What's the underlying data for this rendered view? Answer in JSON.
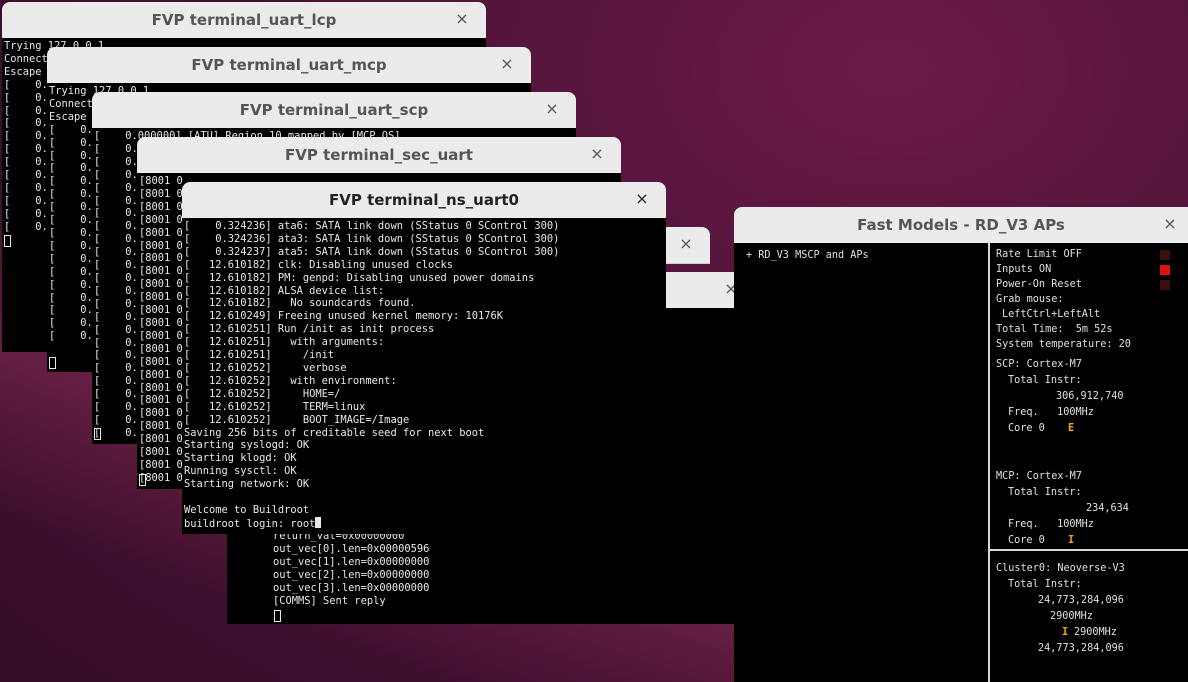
{
  "windows": {
    "lcp": {
      "title": "FVP terminal_uart_lcp",
      "lines": [
        "Trying 127.0.0.1",
        "Connect",
        "Escape",
        "[    0.",
        "[    0.",
        "[    0.",
        "[    0.",
        "[    0.",
        "[    0.",
        "[    0.",
        "[    0.",
        "[    0.",
        "[    0.",
        "[    0.",
        "[    0."
      ]
    },
    "mcp": {
      "title": "FVP terminal_uart_mcp",
      "lines": [
        "Trying 127.0.0.1",
        "Connect",
        "Escape",
        "[    0.",
        "[    0.",
        "[    0.",
        "[    0.",
        "[    0.",
        "[    0.",
        "[    0.",
        "[    0.",
        "[    0.",
        "[    0.",
        "[    0.",
        "[    0.",
        "[    0.",
        "[    0.",
        "[    0.",
        "[    0.",
        "[    0."
      ]
    },
    "scp": {
      "title": "FVP terminal_uart_scp",
      "lines": [
        "[    0.000000] [ATU] Region 10 mapped by [MCP_OS]",
        "[    0.",
        "[    0.",
        "[    0.",
        "[    0.",
        "[    0.",
        "[    0.",
        "[    0.",
        "[    0.",
        "[    0.",
        "[    0.",
        "[    0.",
        "[    0.",
        "[    0.",
        "[    0.",
        "[    0.",
        "[    0.",
        "[    0.",
        "[    0.",
        "[    0.",
        "[    0.",
        "[    0.",
        "[    0.",
        "[    0."
      ]
    },
    "sec": {
      "title": "FVP terminal_sec_uart",
      "lines": [
        "[8001 0",
        "[8001 0",
        "[8001 0",
        "[8001 0",
        "[8001 0",
        "[8001 0",
        "[8001 0",
        "[8001 0",
        "[8001 0",
        "[8001 0",
        "[8001 0",
        "[8001 0",
        "[8001 0",
        "[8001 0",
        "[8001 0",
        "[8001 0",
        "[8001 0",
        "[8001 0",
        "[8001 0",
        "[8001 0",
        "[8001 0",
        "[8001 0",
        "[8001 0",
        "[8001 0"
      ]
    },
    "ns": {
      "title": "FVP terminal_ns_uart0",
      "lines": [
        "[    0.324236] ata6: SATA link down (SStatus 0 SControl 300)",
        "[    0.324236] ata3: SATA link down (SStatus 0 SControl 300)",
        "[    0.324237] ata5: SATA link down (SStatus 0 SControl 300)",
        "[   12.610182] clk: Disabling unused clocks",
        "[   12.610182] PM: genpd: Disabling unused power domains",
        "[   12.610182] ALSA device list:",
        "[   12.610182]   No soundcards found.",
        "[   12.610249] Freeing unused kernel memory: 10176K",
        "[   12.610251] Run /init as init process",
        "[   12.610251]   with arguments:",
        "[   12.610251]     /init",
        "[   12.610252]     verbose",
        "[   12.610252]   with environment:",
        "[   12.610252]     HOME=/",
        "[   12.610252]     TERM=linux",
        "[   12.610252]     BOOT_IMAGE=/Image",
        "Saving 256 bits of creditable seed for next boot",
        "Starting syslogd: OK",
        "Starting klogd: OK",
        "Running sysctl: OK",
        "Starting network: OK",
        "",
        "Welcome to Buildroot"
      ],
      "prompt": "buildroot login: root"
    },
    "rmm": {
      "lines": [
        "return_val=0x00000000",
        "out_vec[0].len=0x00000596",
        "out_vec[1].len=0x00000000",
        "out_vec[2].len=0x00000000",
        "out_vec[3].len=0x00000000",
        "[COMMS] Sent reply"
      ]
    },
    "close_glyph": "×"
  },
  "fast_models": {
    "title": "Fast Models - RD_V3 APs",
    "tree_item": "+ RD_V3 MSCP and APs",
    "status": {
      "rate_limit": "Rate Limit OFF",
      "inputs": "Inputs ON",
      "power_on_reset": "Power-On Reset",
      "grab_mouse_label": "Grab mouse:",
      "grab_mouse_value": "LeftCtrl+LeftAlt",
      "total_time": "Total Time:  5m 52s",
      "system_temperature": "System temperature: 20"
    },
    "scp": {
      "name": "SCP: Cortex-M7",
      "total_instr_label": "Total Instr:",
      "total_instr_value": "306,912,740",
      "freq": "Freq.   100MHz",
      "core_label": "Core 0",
      "core_glyph": "E"
    },
    "mcp": {
      "name": "MCP: Cortex-M7",
      "total_instr_label": "Total Instr:",
      "total_instr_value": "234,634",
      "freq": "Freq.   100MHz",
      "core_label": "Core 0",
      "core_glyph": "I"
    },
    "cluster0": {
      "name": "Cluster0: Neoverse-V3",
      "total_instr_label": "Total Instr:",
      "total_instr_value": "24,773,284,096",
      "freq": "2900MHz",
      "core_glyph": "I",
      "core_freq": "2900MHz",
      "core_instr": "24,773,284,096"
    },
    "colors": {
      "led_off": "#3a0f0f",
      "led_on": "#e01010",
      "core_indicator": "#f2a31f"
    }
  }
}
